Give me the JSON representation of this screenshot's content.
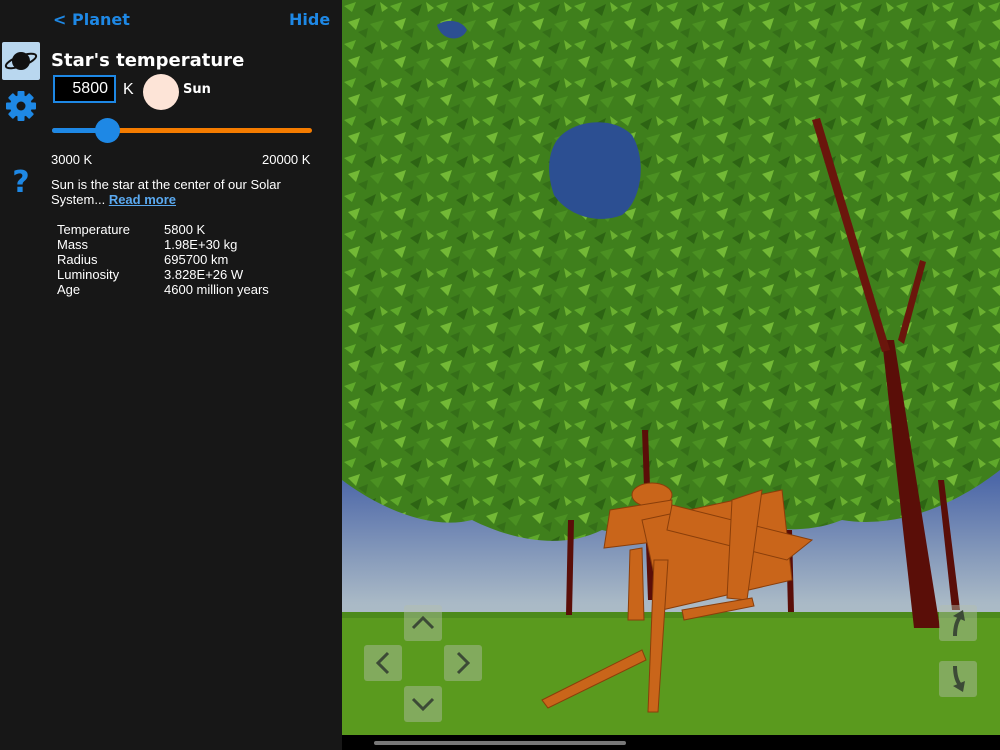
{
  "topbar": {
    "back_label": "< Planet",
    "hide_label": "Hide"
  },
  "panel": {
    "title": "Star's temperature",
    "temperature_value": "5800",
    "unit": "K",
    "star_name": "Sun",
    "slider": {
      "min_label": "3000 K",
      "max_label": "20000 K",
      "min": 3000,
      "max": 20000,
      "value": 5800
    },
    "description": "Sun is the star at the center of our Solar System...",
    "read_more": "Read more",
    "properties": [
      {
        "label": "Temperature",
        "value": "5800 K"
      },
      {
        "label": "Mass",
        "value": "1.98E+30 kg"
      },
      {
        "label": "Radius",
        "value": "695700 km"
      },
      {
        "label": "Luminosity",
        "value": "3.828E+26 W"
      },
      {
        "label": "Age",
        "value": "4600 million years"
      }
    ]
  },
  "rail": {
    "icons": [
      "planet-icon",
      "gear-icon",
      "help-icon"
    ]
  },
  "colors": {
    "accent": "#1e88e5",
    "slider_track": "#f57c00",
    "star": "#fde4d7",
    "panel_bg": "#171717"
  }
}
